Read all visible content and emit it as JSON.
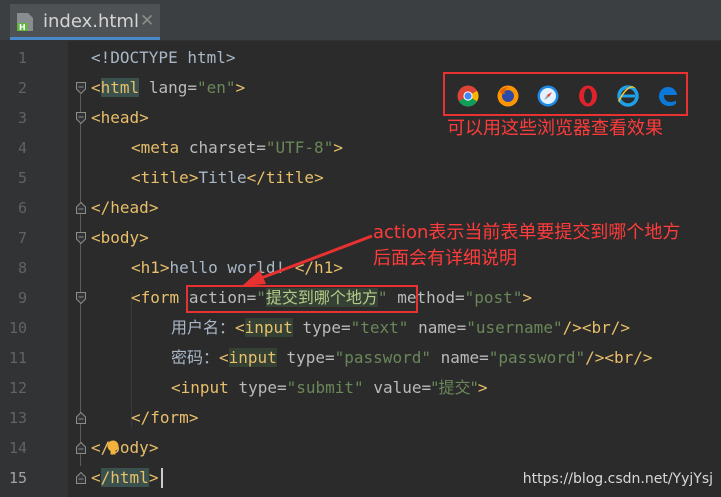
{
  "tab": {
    "filename": "index.html",
    "close": "✕",
    "icon": "html-file-icon"
  },
  "line_numbers": [
    "1",
    "2",
    "3",
    "4",
    "5",
    "6",
    "7",
    "8",
    "9",
    "10",
    "11",
    "12",
    "13",
    "14",
    "15"
  ],
  "code": {
    "l1": "<!DOCTYPE html>",
    "l2_tag": "html",
    "l2_attr": "lang",
    "l2_val": "\"en\"",
    "l3_tag": "head",
    "l4_tag": "meta",
    "l4_attr": "charset",
    "l4_val": "\"UTF-8\"",
    "l5_open": "title",
    "l5_text": "Title",
    "l5_close": "/title",
    "l6_tag": "/head",
    "l7_tag": "body",
    "l8_open": "h1",
    "l8_text": "hello world! ",
    "l8_close": "/h1",
    "l9_tag": "form",
    "l9_attr1": "action",
    "l9_q1": "\"",
    "l9_val1": "提交到哪个地方",
    "l9_q2": "\"",
    "l9_attr2": "method",
    "l9_val2": "\"post\"",
    "l10_label": "用户名：",
    "l10_tag": "input",
    "l10_attr1": "type",
    "l10_val1": "\"text\"",
    "l10_attr2": "name",
    "l10_val2": "\"username\"",
    "l10_end": "/><br/>",
    "l11_label": "密码：",
    "l11_tag": "input",
    "l11_attr1": "type",
    "l11_val1": "\"password\"",
    "l11_attr2": "name",
    "l11_val2": "\"password\"",
    "l11_end": "/><br/>",
    "l12_tag": "input",
    "l12_attr1": "type",
    "l12_val1": "\"submit\"",
    "l12_attr2": "value",
    "l12_val2": "\"提交\"",
    "l12_end": ">",
    "l13_tag": "/form",
    "l14_tag": "/body",
    "l15_tag": "/html"
  },
  "annotations": {
    "browsers_caption": "可以用这些浏览器查看效果",
    "action_line1": "action表示当前表单要提交到哪个地方",
    "action_line2": "后面会有详细说明",
    "browsers": [
      "chrome-icon",
      "firefox-icon",
      "safari-icon",
      "opera-icon",
      "ie-icon",
      "edge-icon"
    ]
  },
  "colors": {
    "background": "#2b2b2b",
    "tag": "#e8bf6a",
    "attribute": "#bababa",
    "string": "#6a8759",
    "annotation": "#e83131"
  },
  "watermark": "https://blog.csdn.net/YyjYsj"
}
